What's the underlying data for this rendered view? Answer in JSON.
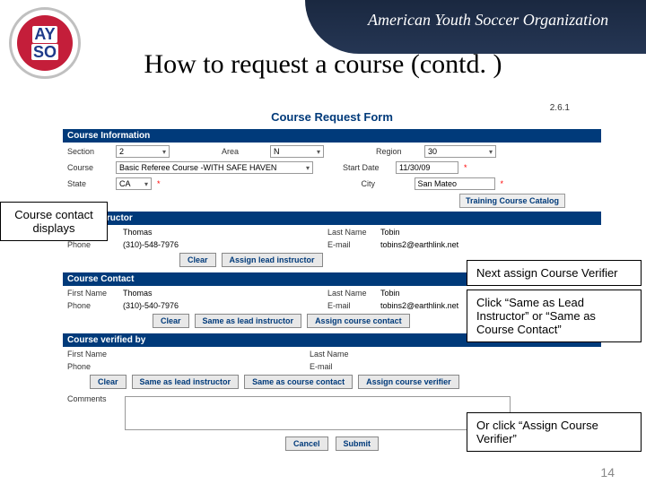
{
  "slide": {
    "title": "How to request a course (contd. )",
    "page_number": "14",
    "banner_text": "American Youth Soccer Organization",
    "logo": {
      "line1": "AY",
      "line2": "SO"
    }
  },
  "callouts": {
    "c1": "Course contact displays",
    "c2": "Next assign Course Verifier",
    "c3": "Click “Same as Lead Instructor” or “Same as Course Contact”",
    "c4": "Or click “Assign Course Verifier”"
  },
  "form": {
    "version": "2.6.1",
    "title": "Course Request Form",
    "sections": {
      "info": "Course Information",
      "lead": "Lead Instructor",
      "contact": "Course Contact",
      "verifier": "Course verified by"
    },
    "labels": {
      "section": "Section",
      "area": "Area",
      "region": "Region",
      "course": "Course",
      "start_date": "Start Date",
      "state": "State",
      "city": "City",
      "first_name": "First Name",
      "last_name": "Last Name",
      "phone": "Phone",
      "email": "E-mail",
      "comments": "Comments"
    },
    "values": {
      "section": "2",
      "area": "N",
      "region": "30",
      "course": "Basic Referee Course -WITH SAFE HAVEN",
      "start_date": "11/30/09",
      "state": "CA",
      "city": "San Mateo",
      "first_name": "Thomas",
      "last_name": "Tobin",
      "phone": "(310)-548-7976",
      "email": "tobins2@earthlink.net",
      "contact_first": "Thomas",
      "contact_last": "Tobin",
      "contact_phone": "(310)-540-7976",
      "contact_email": "tobins2@earthlink.net"
    },
    "buttons": {
      "catalog": "Training Course Catalog",
      "clear": "Clear",
      "assign_lead": "Assign lead instructor",
      "same_lead": "Same as lead instructor",
      "assign_contact": "Assign course contact",
      "same_contact": "Same as course contact",
      "assign_verifier": "Assign course verifier",
      "cancel": "Cancel",
      "submit": "Submit"
    }
  }
}
